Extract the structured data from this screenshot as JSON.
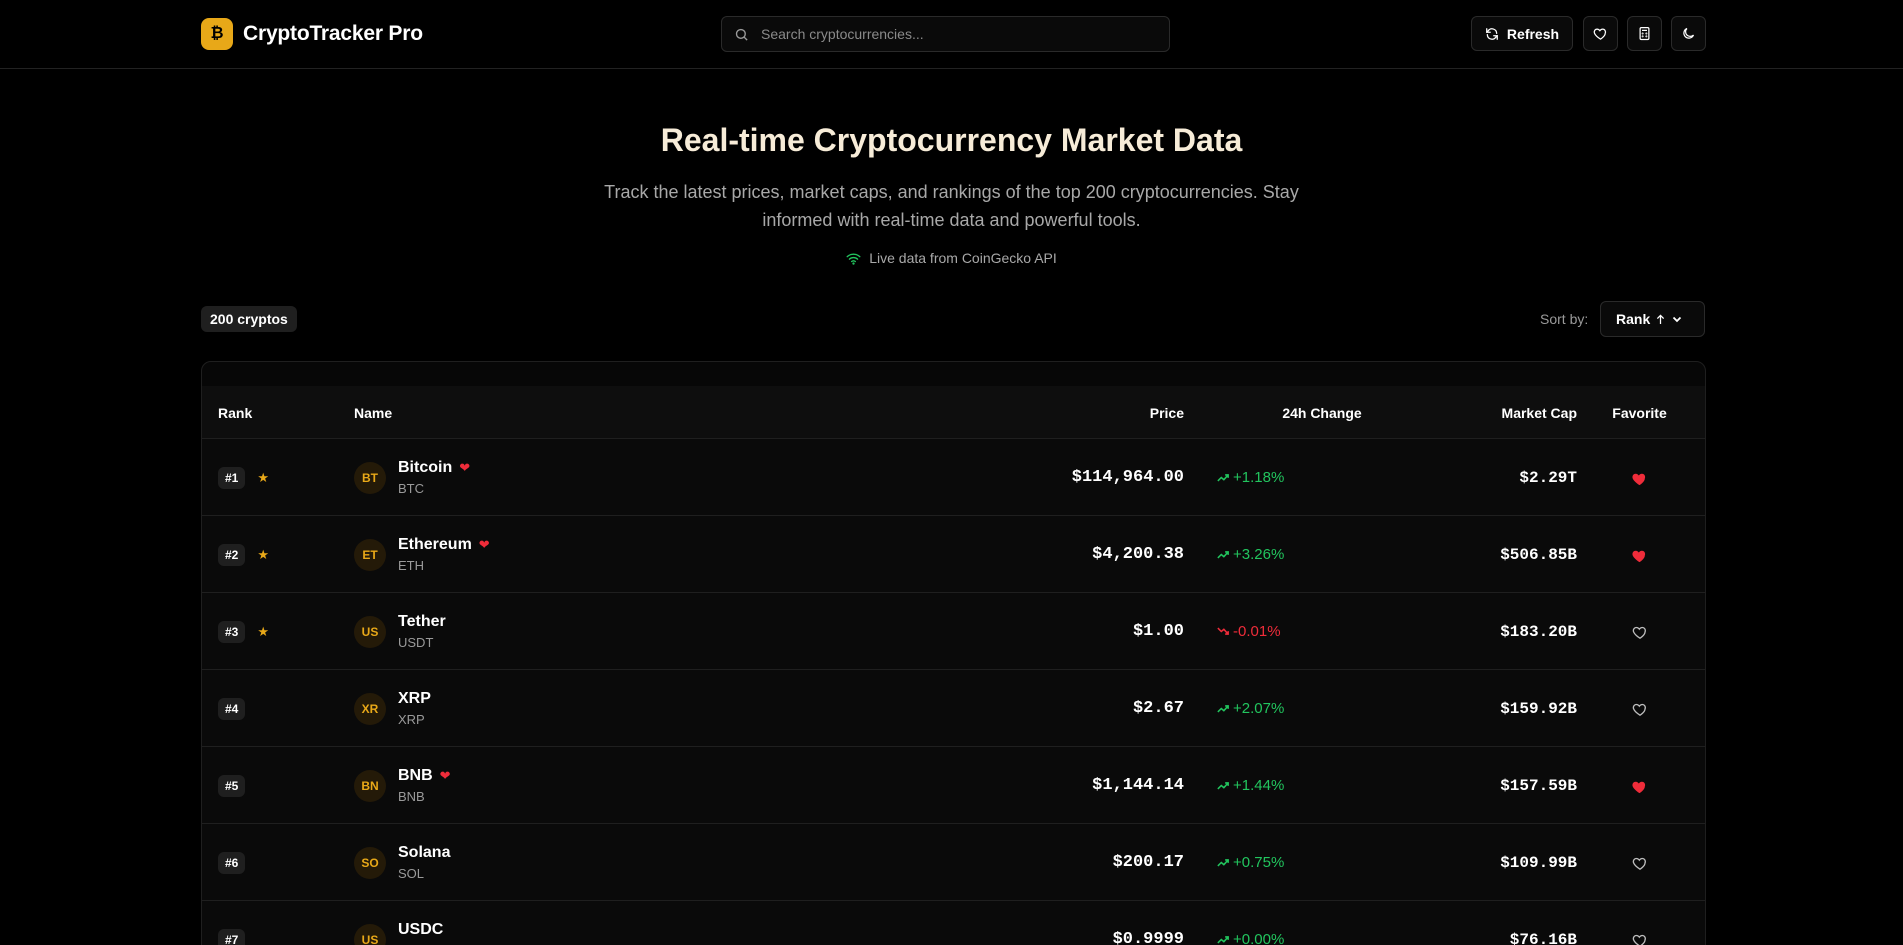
{
  "app": {
    "logo_glyph": "₿",
    "title": "CryptoTracker Pro",
    "brand_color": "#e8a818"
  },
  "header": {
    "search_placeholder": "Search cryptocurrencies...",
    "refresh_label": "Refresh"
  },
  "hero": {
    "title": "Real-time Cryptocurrency Market Data",
    "subtitle": "Track the latest prices, market caps, and rankings of the top 200 cryptocurrencies. Stay informed with real-time data and powerful tools.",
    "live_text": "Live data from CoinGecko API"
  },
  "toolbar": {
    "count": "200 cryptos",
    "sort_label": "Sort by:",
    "sort_value": "Rank"
  },
  "table": {
    "columns": {
      "rank": "Rank",
      "name": "Name",
      "price": "Price",
      "change": "24h Change",
      "market_cap": "Market Cap",
      "favorite": "Favorite"
    },
    "rows": [
      {
        "rank": "#1",
        "starred": true,
        "avatar": "BT",
        "name": "Bitcoin",
        "symbol": "BTC",
        "favorite": true,
        "price": "$114,964.00",
        "change": "+1.18%",
        "direction": "up",
        "market_cap": "$2.29T"
      },
      {
        "rank": "#2",
        "starred": true,
        "avatar": "ET",
        "name": "Ethereum",
        "symbol": "ETH",
        "favorite": true,
        "price": "$4,200.38",
        "change": "+3.26%",
        "direction": "up",
        "market_cap": "$506.85B"
      },
      {
        "rank": "#3",
        "starred": true,
        "avatar": "US",
        "name": "Tether",
        "symbol": "USDT",
        "favorite": false,
        "price": "$1.00",
        "change": "-0.01%",
        "direction": "down",
        "market_cap": "$183.20B"
      },
      {
        "rank": "#4",
        "starred": false,
        "avatar": "XR",
        "name": "XRP",
        "symbol": "XRP",
        "favorite": false,
        "price": "$2.67",
        "change": "+2.07%",
        "direction": "up",
        "market_cap": "$159.92B"
      },
      {
        "rank": "#5",
        "starred": false,
        "avatar": "BN",
        "name": "BNB",
        "symbol": "BNB",
        "favorite": true,
        "price": "$1,144.14",
        "change": "+1.44%",
        "direction": "up",
        "market_cap": "$157.59B"
      },
      {
        "rank": "#6",
        "starred": false,
        "avatar": "SO",
        "name": "Solana",
        "symbol": "SOL",
        "favorite": false,
        "price": "$200.17",
        "change": "+0.75%",
        "direction": "up",
        "market_cap": "$109.99B"
      },
      {
        "rank": "#7",
        "starred": false,
        "avatar": "US",
        "name": "USDC",
        "symbol": "USDC",
        "favorite": false,
        "price": "$0.9999",
        "change": "+0.00%",
        "direction": "up",
        "market_cap": "$76.16B"
      }
    ]
  },
  "colors": {
    "up": "#22c55e",
    "down": "#ef2c3a",
    "favorite_on": "#ef2c3a"
  },
  "icons": {
    "search": "search-icon",
    "refresh": "refresh-icon",
    "favorites": "heart-icon",
    "calculator": "calculator-icon",
    "theme": "moon-icon",
    "live": "wifi-icon",
    "sort_direction": "arrow-up-icon",
    "sort_dropdown": "chevron-down-icon"
  }
}
